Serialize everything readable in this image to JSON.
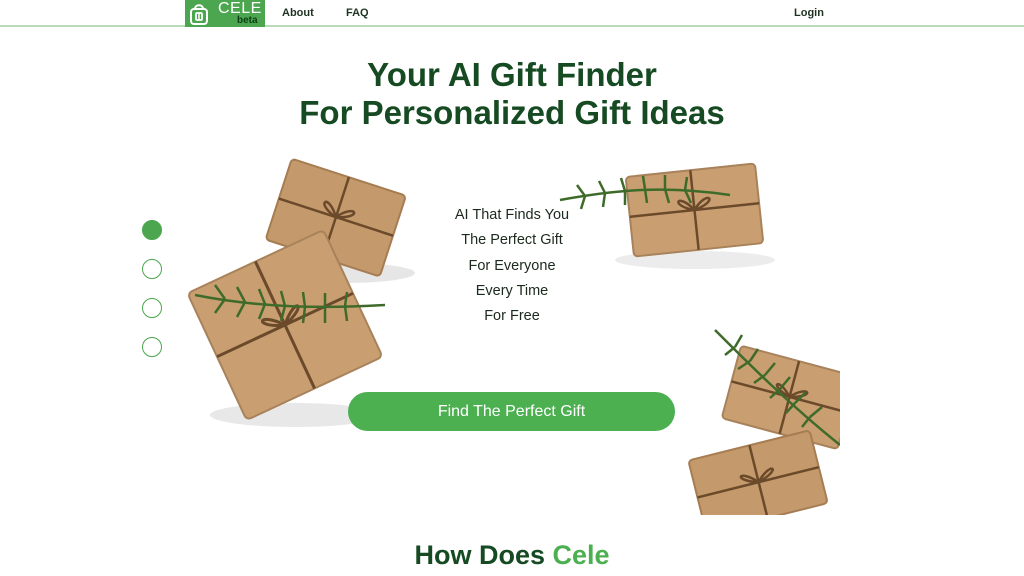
{
  "nav": {
    "logo_name": "CELE",
    "logo_badge": "beta",
    "about": "About",
    "faq": "FAQ",
    "login": "Login"
  },
  "hero": {
    "title_line1": "Your AI Gift Finder",
    "title_line2": "For Personalized Gift Ideas",
    "tagline": [
      "AI That Finds You",
      "The Perfect Gift",
      "For Everyone",
      "Every Time",
      "For Free"
    ],
    "cta_label": "Find The Perfect Gift",
    "carousel_dots": [
      {
        "state": "active"
      },
      {
        "state": "inactive"
      },
      {
        "state": "inactive"
      },
      {
        "state": "inactive"
      }
    ]
  },
  "section": {
    "how_prefix": "How Does ",
    "how_accent": "Cele"
  },
  "colors": {
    "brand_green": "#4ba64f",
    "dark_green": "#164a22",
    "kraft_paper": "#c99f72"
  }
}
